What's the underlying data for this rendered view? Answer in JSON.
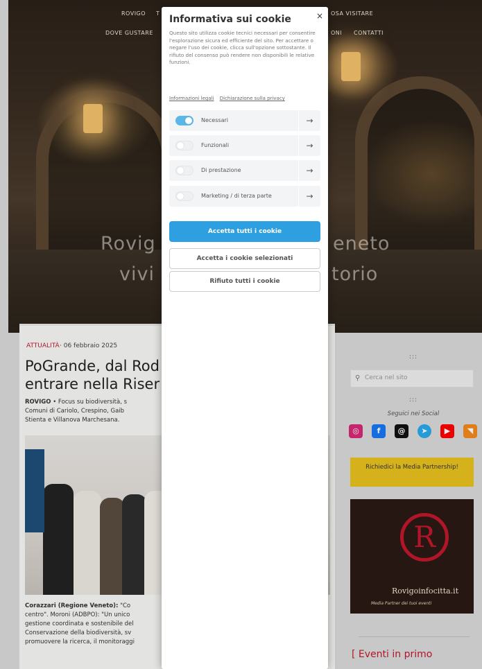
{
  "nav": {
    "row1": [
      "ROVIGO",
      "T",
      "OSA VISITARE"
    ],
    "row2": [
      "DOVE GUSTARE",
      "ONI",
      "CONTATTI"
    ]
  },
  "hero": {
    "tagline_left_1": "Rovig",
    "tagline_right_1": "eneto",
    "tagline_left_2": "vivi",
    "tagline_right_2": "torio"
  },
  "article": {
    "category": "ATTUALITÀ",
    "date": "· 06 febbraio 2025",
    "title_line1": "PoGrande, dal Rod",
    "title_line2": "entrare nella Riser",
    "lead_bold": "ROVIGO",
    "lead_text": " • Focus su biodiversità, s",
    "lead_line2": "Comuni di Cariolo, Crespino, Gaib",
    "lead_line3": "Stienta e Villanova Marchesana.",
    "caption_bold": "Corazzari (Regione Veneto):",
    "caption_text": " \"Co",
    "caption_line2": "centro\". Moroni (ADBPO): \"Un unico",
    "caption_line3": "gestione coordinata e sostenibile del",
    "caption_line4": "Conservazione della biodiversità, sv",
    "caption_line5": "promuovere la ricerca, il monitoraggi"
  },
  "sidebar": {
    "dots_top": ":::",
    "search_placeholder": "Cerca nel sito",
    "dots_mid": ":::",
    "social_label": "Seguici nei Social",
    "socials": [
      {
        "icon": "instagram-icon",
        "glyph": "◎",
        "color": "#d62976"
      },
      {
        "icon": "facebook-icon",
        "glyph": "f",
        "color": "#1877f2"
      },
      {
        "icon": "threads-icon",
        "glyph": "@",
        "color": "#111111"
      },
      {
        "icon": "telegram-icon",
        "glyph": "➤",
        "color": "#29a9eb"
      },
      {
        "icon": "youtube-icon",
        "glyph": "▶",
        "color": "#ff0000"
      },
      {
        "icon": "rss-icon",
        "glyph": "◥",
        "color": "#f2891d"
      }
    ],
    "partner_button": "Richiedici la Media Partnership!",
    "banner_letter": "R",
    "banner_brand": "Rovigoinfocitta.it",
    "banner_sub": "Media Partner dei tuoi eventi",
    "events_heading": "[ Eventi in primo"
  },
  "cookie": {
    "title": "Informativa sui cookie",
    "close_glyph": "×",
    "description": "Questo sito utilizza cookie tecnici necessari per consentire l'esplorazione sicura ed efficiente del sito. Per accettare o negare l'uso dei cookie, clicca sull'opzione sottostante. Il rifiuto del consenso può rendere non disponibili le relative funzioni.",
    "link_legal": "Informazioni legali",
    "link_privacy": "Dichiarazione sulla privacy",
    "categories": [
      {
        "label": "Necessari",
        "enabled": true
      },
      {
        "label": "Funzionali",
        "enabled": false
      },
      {
        "label": "Di prestazione",
        "enabled": false
      },
      {
        "label": "Marketing / di terza parte",
        "enabled": false
      }
    ],
    "arrow_glyph": "→",
    "accept_all": "Accetta tutti i cookie",
    "accept_selected": "Accetta i cookie selezionati",
    "reject_all": "Rifiuto tutti i cookie"
  }
}
